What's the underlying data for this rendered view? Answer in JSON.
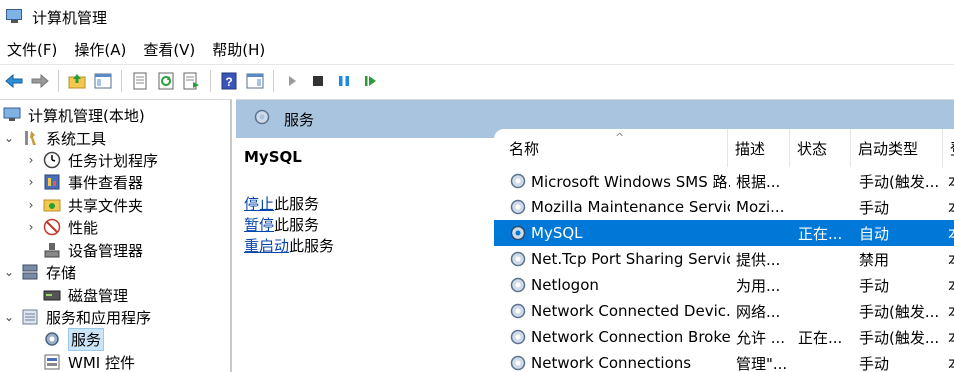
{
  "window": {
    "title": "计算机管理"
  },
  "menu": [
    "文件(F)",
    "操作(A)",
    "查看(V)",
    "帮助(H)"
  ],
  "toolbar": {
    "icons": [
      "back-arrow-icon",
      "forward-arrow-icon",
      "up-folder-icon",
      "show-hide-tree-icon",
      "properties-icon",
      "refresh-icon",
      "export-list-icon",
      "help-icon",
      "show-hide-action-pane-icon",
      "start-service-icon",
      "stop-service-icon",
      "pause-service-icon",
      "restart-service-icon"
    ]
  },
  "tree": {
    "items": [
      {
        "label": "计算机管理(本地)"
      },
      {
        "label": "系统工具"
      },
      {
        "label": "任务计划程序"
      },
      {
        "label": "事件查看器"
      },
      {
        "label": "共享文件夹"
      },
      {
        "label": "性能"
      },
      {
        "label": "设备管理器"
      },
      {
        "label": "存储"
      },
      {
        "label": "磁盘管理"
      },
      {
        "label": "服务和应用程序"
      },
      {
        "label": "服务"
      },
      {
        "label": "WMI 控件"
      }
    ]
  },
  "main": {
    "header_title": "服务",
    "selected_service": "MySQL",
    "actions": [
      {
        "link": "停止",
        "rest": "此服务"
      },
      {
        "link": "暂停",
        "rest": "此服务"
      },
      {
        "link": "重启动",
        "rest": "此服务"
      }
    ],
    "columns": [
      "名称",
      "描述",
      "状态",
      "启动类型",
      "登"
    ],
    "rows": [
      {
        "name": "Microsoft Windows SMS 路...",
        "desc": "根据...",
        "status": "",
        "start": "手动(触发...",
        "logon": "本"
      },
      {
        "name": "Mozilla Maintenance Service",
        "desc": "Mozi...",
        "status": "",
        "start": "手动",
        "logon": "本"
      },
      {
        "name": "MySQL",
        "desc": "",
        "status": "正在...",
        "start": "自动",
        "logon": "本"
      },
      {
        "name": "Net.Tcp Port Sharing Service",
        "desc": "提供...",
        "status": "",
        "start": "禁用",
        "logon": "本"
      },
      {
        "name": "Netlogon",
        "desc": "为用...",
        "status": "",
        "start": "手动",
        "logon": "本"
      },
      {
        "name": "Network Connected Devic...",
        "desc": "网络...",
        "status": "",
        "start": "手动(触发...",
        "logon": "本"
      },
      {
        "name": "Network Connection Broker",
        "desc": "允许 ...",
        "status": "正在...",
        "start": "手动(触发...",
        "logon": "本"
      },
      {
        "name": "Network Connections",
        "desc": "管理\"...",
        "status": "",
        "start": "手动",
        "logon": "本"
      }
    ]
  },
  "colors": {
    "selection": "#0078d7",
    "header_band": "#a8c4de",
    "link": "#0645ad"
  }
}
